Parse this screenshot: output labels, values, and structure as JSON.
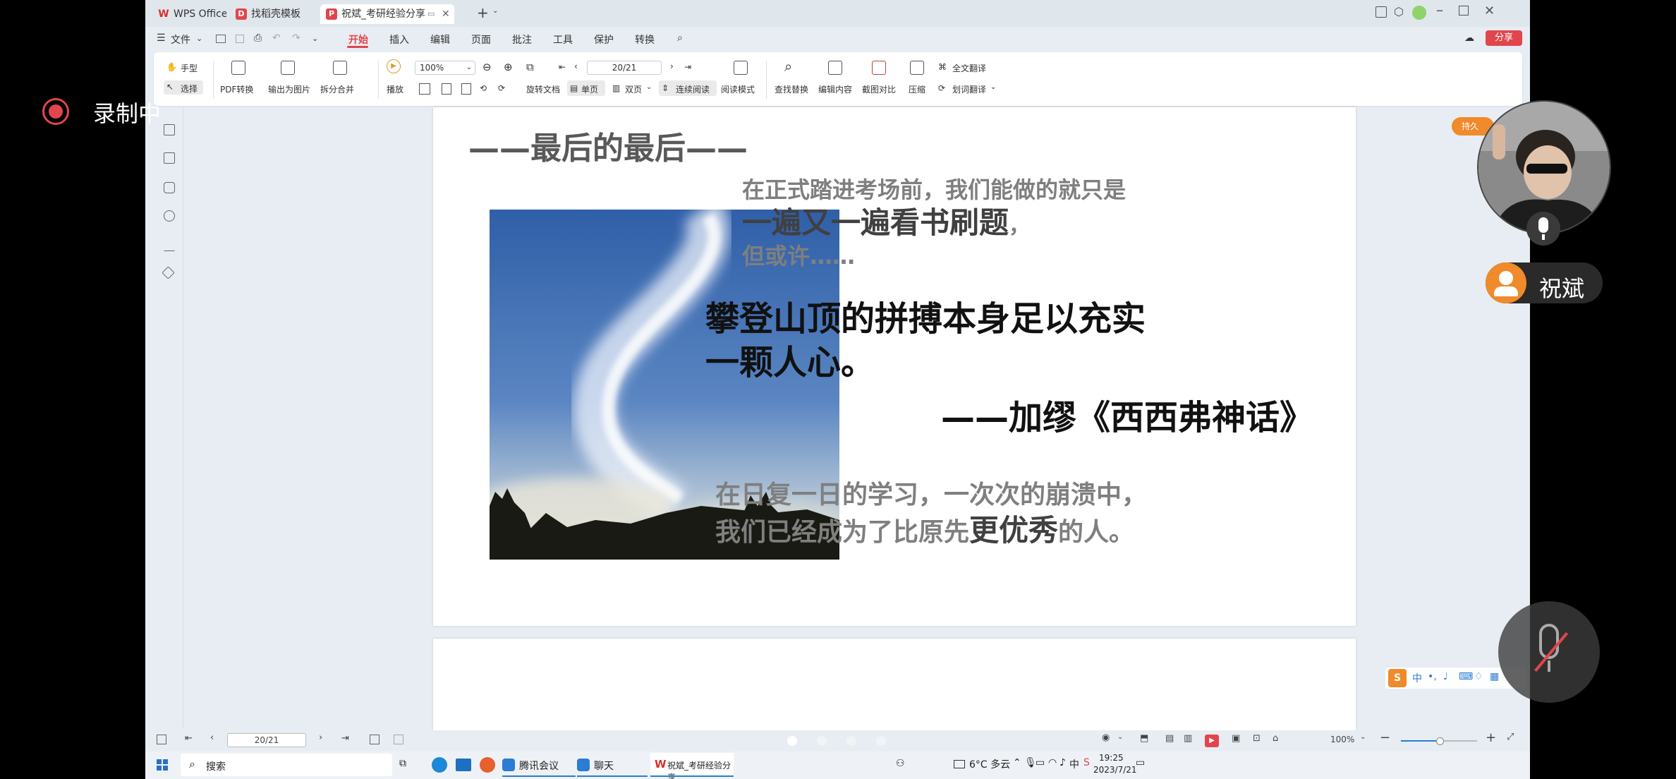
{
  "tabs": [
    {
      "label": "WPS Office"
    },
    {
      "label": "找稻壳模板"
    },
    {
      "label": "祝斌_考研经验分享"
    }
  ],
  "menu": {
    "file": "文件",
    "items": [
      "开始",
      "插入",
      "编辑",
      "页面",
      "批注",
      "工具",
      "保护",
      "转换"
    ],
    "share": "分享"
  },
  "ribbon": {
    "hand": "手型",
    "select": "选择",
    "pdf_convert": "PDF转换",
    "export_image": "输出为图片",
    "split_merge": "拆分合并",
    "play": "播放",
    "zoom": "100%",
    "page": "20/21",
    "rotate": "旋转文档",
    "single": "单页",
    "double": "双页",
    "continuous": "连续阅读",
    "read_mode": "阅读模式",
    "find_replace": "查找替换",
    "edit_content": "编辑内容",
    "screenshot_compare": "截图对比",
    "compress": "压缩",
    "full_translate": "全文翻译",
    "word_translate": "划词翻译"
  },
  "slide": {
    "title": "——最后的最后——",
    "p1_line1": "在正式踏进考场前，我们能做的就只是",
    "p1_line2": "一遍又一遍看书刷题",
    "p1_comma": "，",
    "p1_line3": "但或许……",
    "quote_line1": "攀登山顶的拼搏本身足以充实",
    "quote_line2": "一颗人心。",
    "attribution": "——加缪《西西弗神话》",
    "p3_line1": "在日复一日的学习，一次次的崩溃中，",
    "p3_line2a": "我们已经成为了比原先",
    "p3_line2b": "更优秀",
    "p3_line2c": "的人。"
  },
  "status": {
    "page": "20/21",
    "zoom": "100%"
  },
  "taskbar": {
    "search": "搜索",
    "apps": [
      "腾讯会议",
      "聊天",
      "祝斌_考研经验分享..."
    ],
    "weather": "6°C 多云",
    "time": "19:25",
    "date": "2023/7/21",
    "ime": "中"
  },
  "overlay": {
    "recording": "录制中",
    "user_name": "祝斌",
    "badge": "持久"
  },
  "colors": {
    "accent": "#e1464c",
    "wps_red": "#d9302c",
    "orange": "#f08a2a",
    "gray_text": "#7f7f7f"
  }
}
